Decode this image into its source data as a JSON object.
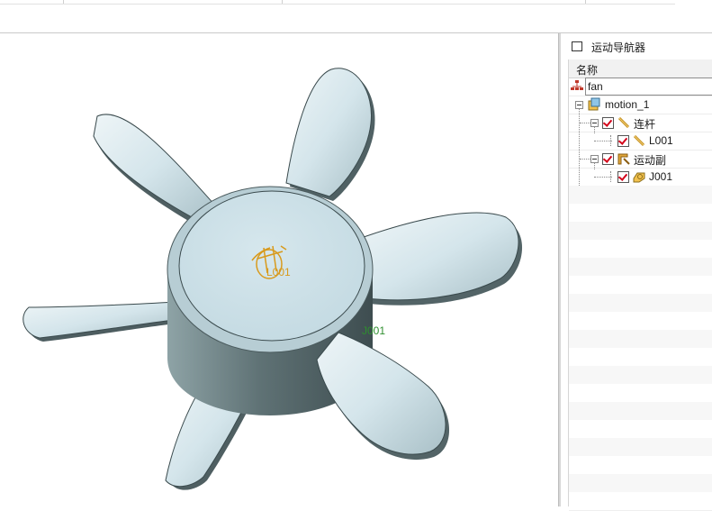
{
  "navigator": {
    "title": "运动导航器",
    "column_header": "名称",
    "items": [
      {
        "label": "fan",
        "icon": "assembly-tree-icon"
      },
      {
        "label": "motion_1",
        "icon": "motion-sim-icon"
      },
      {
        "label": "连杆",
        "icon": "link-group-icon",
        "checked": true
      },
      {
        "label": "L001",
        "icon": "link-icon",
        "checked": true
      },
      {
        "label": "运动副",
        "icon": "joint-group-icon",
        "checked": true
      },
      {
        "label": "J001",
        "icon": "revolute-joint-icon",
        "checked": true
      }
    ]
  },
  "viewport": {
    "link_label": "L001",
    "joint_label": "J001",
    "colors": {
      "fan_body": "#cfe2e9",
      "fan_shadow": "#5b6d70",
      "link_symbol": "#d89a1c",
      "joint_symbol": "#2f8f2f"
    }
  }
}
